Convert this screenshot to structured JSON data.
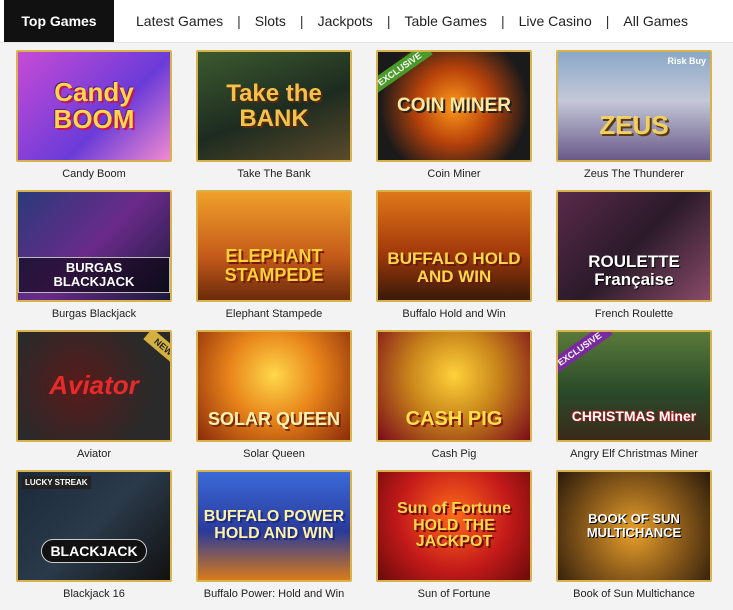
{
  "nav": {
    "tabs": [
      {
        "label": "Top Games",
        "active": true
      },
      {
        "label": "Latest Games",
        "active": false
      },
      {
        "label": "Slots",
        "active": false
      },
      {
        "label": "Jackpots",
        "active": false
      },
      {
        "label": "Table Games",
        "active": false
      },
      {
        "label": "Live Casino",
        "active": false
      },
      {
        "label": "All Games",
        "active": false
      }
    ],
    "separator": "|"
  },
  "games": [
    {
      "title": "Candy Boom",
      "art": "Candy BOOM"
    },
    {
      "title": "Take The Bank",
      "art": "Take the BANK"
    },
    {
      "title": "Coin Miner",
      "art": "COIN MINER",
      "badge": "EXCLUSIVE"
    },
    {
      "title": "Zeus The Thunderer",
      "art": "ZEUS",
      "badge": "Risk Buy"
    },
    {
      "title": "Burgas Blackjack",
      "art": "BURGAS BLACKJACK"
    },
    {
      "title": "Elephant Stampede",
      "art": "ELEPHANT STAMPEDE"
    },
    {
      "title": "Buffalo Hold and Win",
      "art": "BUFFALO HOLD AND WIN"
    },
    {
      "title": "French Roulette",
      "art": "ROULETTE Française"
    },
    {
      "title": "Aviator",
      "art": "Aviator",
      "badge": "NEW"
    },
    {
      "title": "Solar Queen",
      "art": "SOLAR QUEEN"
    },
    {
      "title": "Cash Pig",
      "art": "CASH PIG"
    },
    {
      "title": "Angry Elf Christmas Miner",
      "art": "CHRISTMAS Miner",
      "badge": "EXCLUSIVE"
    },
    {
      "title": "Blackjack 16",
      "art": "BLACKJACK",
      "badge": "LUCKY STREAK"
    },
    {
      "title": "Buffalo Power: Hold and Win",
      "art": "BUFFALO POWER HOLD AND WIN"
    },
    {
      "title": "Sun of Fortune",
      "art": "Sun of Fortune HOLD THE JACKPOT"
    },
    {
      "title": "Book of Sun Multichance",
      "art": "BOOK OF SUN MULTICHANCE"
    }
  ]
}
